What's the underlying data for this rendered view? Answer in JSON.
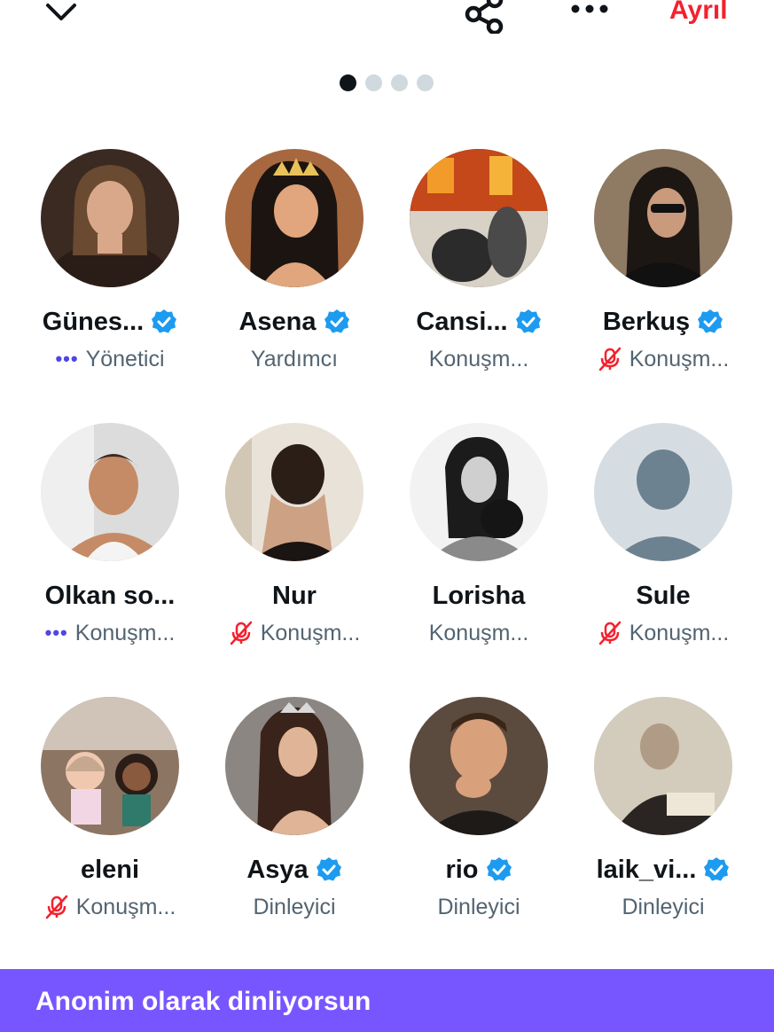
{
  "header": {
    "collapse_icon": "chevron-down-icon",
    "share_icon": "share-icon",
    "more_icon": "more-icon",
    "leave_label": "Ayrıl",
    "leave_color": "#f4212e"
  },
  "pager": {
    "total": 4,
    "active_index": 0
  },
  "participants": [
    {
      "name": "Günes...",
      "verified": true,
      "status": "speaking",
      "role": "Yönetici"
    },
    {
      "name": "Asena",
      "verified": true,
      "status": "none",
      "role": "Yardımcı"
    },
    {
      "name": "Cansi...",
      "verified": true,
      "status": "none",
      "role": "Konuşm..."
    },
    {
      "name": "Berkuş",
      "verified": true,
      "status": "muted",
      "role": "Konuşm..."
    },
    {
      "name": "Olkan so...",
      "verified": false,
      "status": "speaking",
      "role": "Konuşm..."
    },
    {
      "name": "Nur",
      "verified": false,
      "status": "muted",
      "role": "Konuşm..."
    },
    {
      "name": "Lorisha",
      "verified": false,
      "status": "none",
      "role": "Konuşm..."
    },
    {
      "name": "Sule",
      "verified": false,
      "status": "muted",
      "role": "Konuşm..."
    },
    {
      "name": "eleni",
      "verified": false,
      "status": "muted",
      "role": "Konuşm..."
    },
    {
      "name": "Asya",
      "verified": true,
      "status": "none",
      "role": "Dinleyici"
    },
    {
      "name": "rio",
      "verified": true,
      "status": "none",
      "role": "Dinleyici"
    },
    {
      "name": "laik_vi...",
      "verified": true,
      "status": "none",
      "role": "Dinleyici"
    }
  ],
  "banner": {
    "text": "Anonim olarak dinliyorsun",
    "color": "#7856ff"
  },
  "colors": {
    "verified": "#1d9bf0",
    "muted": "#f4212e",
    "speaking": "#4f46e5"
  }
}
